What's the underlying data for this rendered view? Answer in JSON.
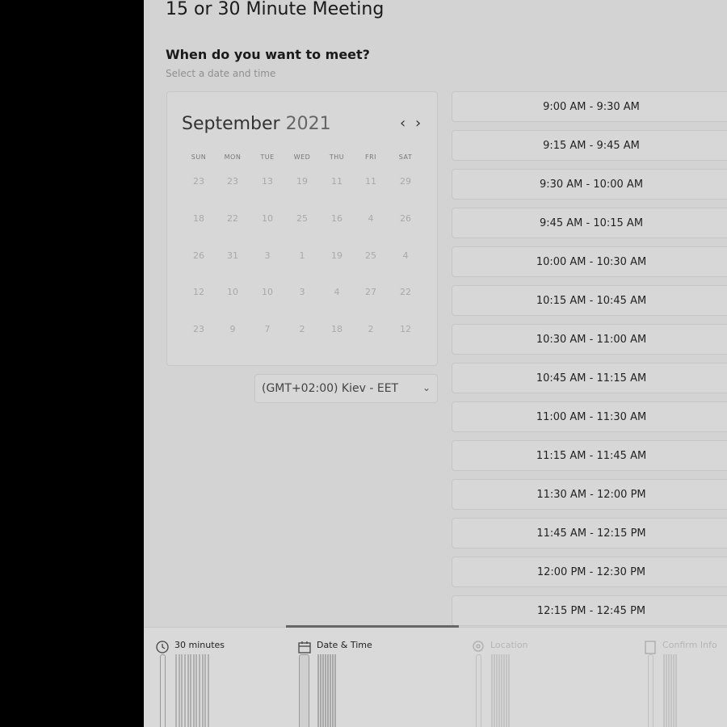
{
  "page": {
    "title": "15 or 30 Minute Meeting",
    "question": "When do you want to meet?",
    "subtitle": "Select a date and time"
  },
  "calendar": {
    "month": "September",
    "year": "2021",
    "prev_icon": "chevron-left-icon",
    "next_icon": "chevron-right-icon",
    "weekdays": [
      "SUN",
      "MON",
      "TUE",
      "WED",
      "THU",
      "FRI",
      "SAT"
    ],
    "weeks": [
      [
        "23",
        "23",
        "13",
        "19",
        "11",
        "11",
        "29"
      ],
      [
        "18",
        "22",
        "10",
        "25",
        "16",
        "4",
        "26"
      ],
      [
        "26",
        "31",
        "3",
        "1",
        "19",
        "25",
        "4"
      ],
      [
        "12",
        "10",
        "10",
        "3",
        "4",
        "27",
        "22"
      ],
      [
        "23",
        "9",
        "7",
        "2",
        "18",
        "2",
        "12"
      ]
    ]
  },
  "timezone": {
    "value": "(GMT+02:00) Kiev - EET",
    "icon": "chevron-down-icon"
  },
  "slots": [
    "9:00 AM - 9:30 AM",
    "9:15 AM - 9:45 AM",
    "9:30 AM - 10:00 AM",
    "9:45 AM - 10:15 AM",
    "10:00 AM - 10:30 AM",
    "10:15 AM - 10:45 AM",
    "10:30 AM - 11:00 AM",
    "10:45 AM - 11:15 AM",
    "11:00 AM - 11:30 AM",
    "11:15 AM - 11:45 AM",
    "11:30 AM - 12:00 PM",
    "11:45 AM - 12:15 PM",
    "12:00 PM - 12:30 PM",
    "12:15 PM - 12:45 PM"
  ],
  "steps": [
    {
      "label": "30 minutes",
      "icon": "clock-icon",
      "state": "done"
    },
    {
      "label": "Date & Time",
      "icon": "calendar-icon",
      "state": "active"
    },
    {
      "label": "Location",
      "icon": "location-pin-icon",
      "state": "pending"
    },
    {
      "label": "Confirm Info",
      "icon": "form-icon",
      "state": "pending"
    }
  ]
}
